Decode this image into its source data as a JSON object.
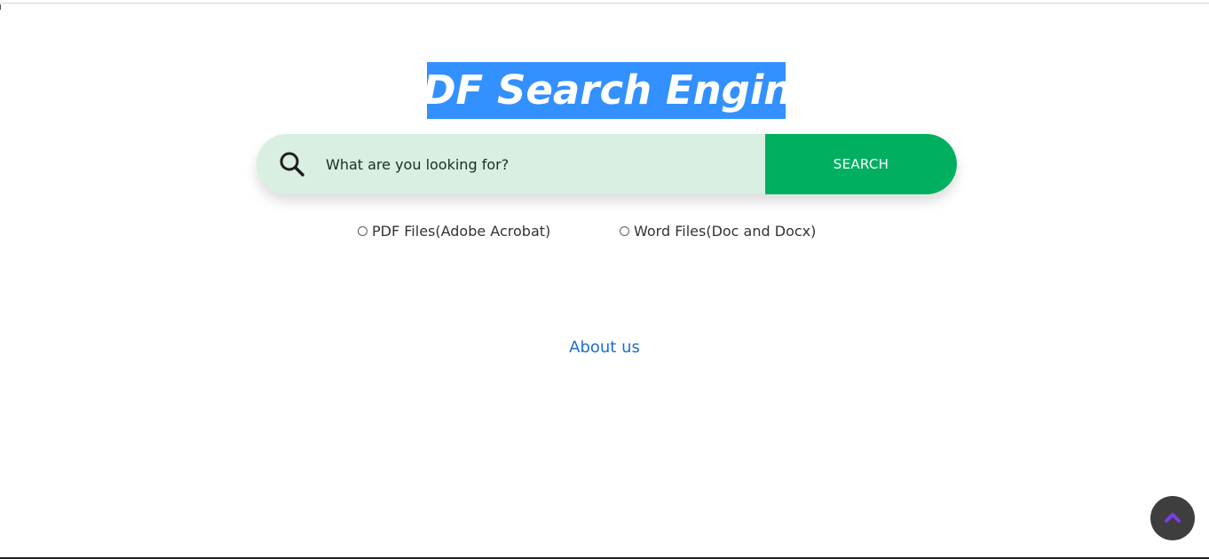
{
  "header": {
    "title": "PDF Search Engine"
  },
  "search": {
    "placeholder": "What are you looking for?",
    "button_label": "SEARCH",
    "icon": "search-icon"
  },
  "filters": {
    "options": [
      {
        "label": "PDF Files(Adobe Acrobat)",
        "selected": false
      },
      {
        "label": "Word Files(Doc and Docx)",
        "selected": false
      }
    ]
  },
  "footer": {
    "about_label": "About us"
  },
  "scroll_top": {
    "icon": "chevron-up-icon"
  },
  "colors": {
    "title_highlight": "#3390ff",
    "search_bar": "#d8efe2",
    "search_button": "#00b060",
    "link": "#1a6fd6",
    "scroll_button": "#3e3e3e",
    "scroll_icon": "#7b3fe4"
  }
}
